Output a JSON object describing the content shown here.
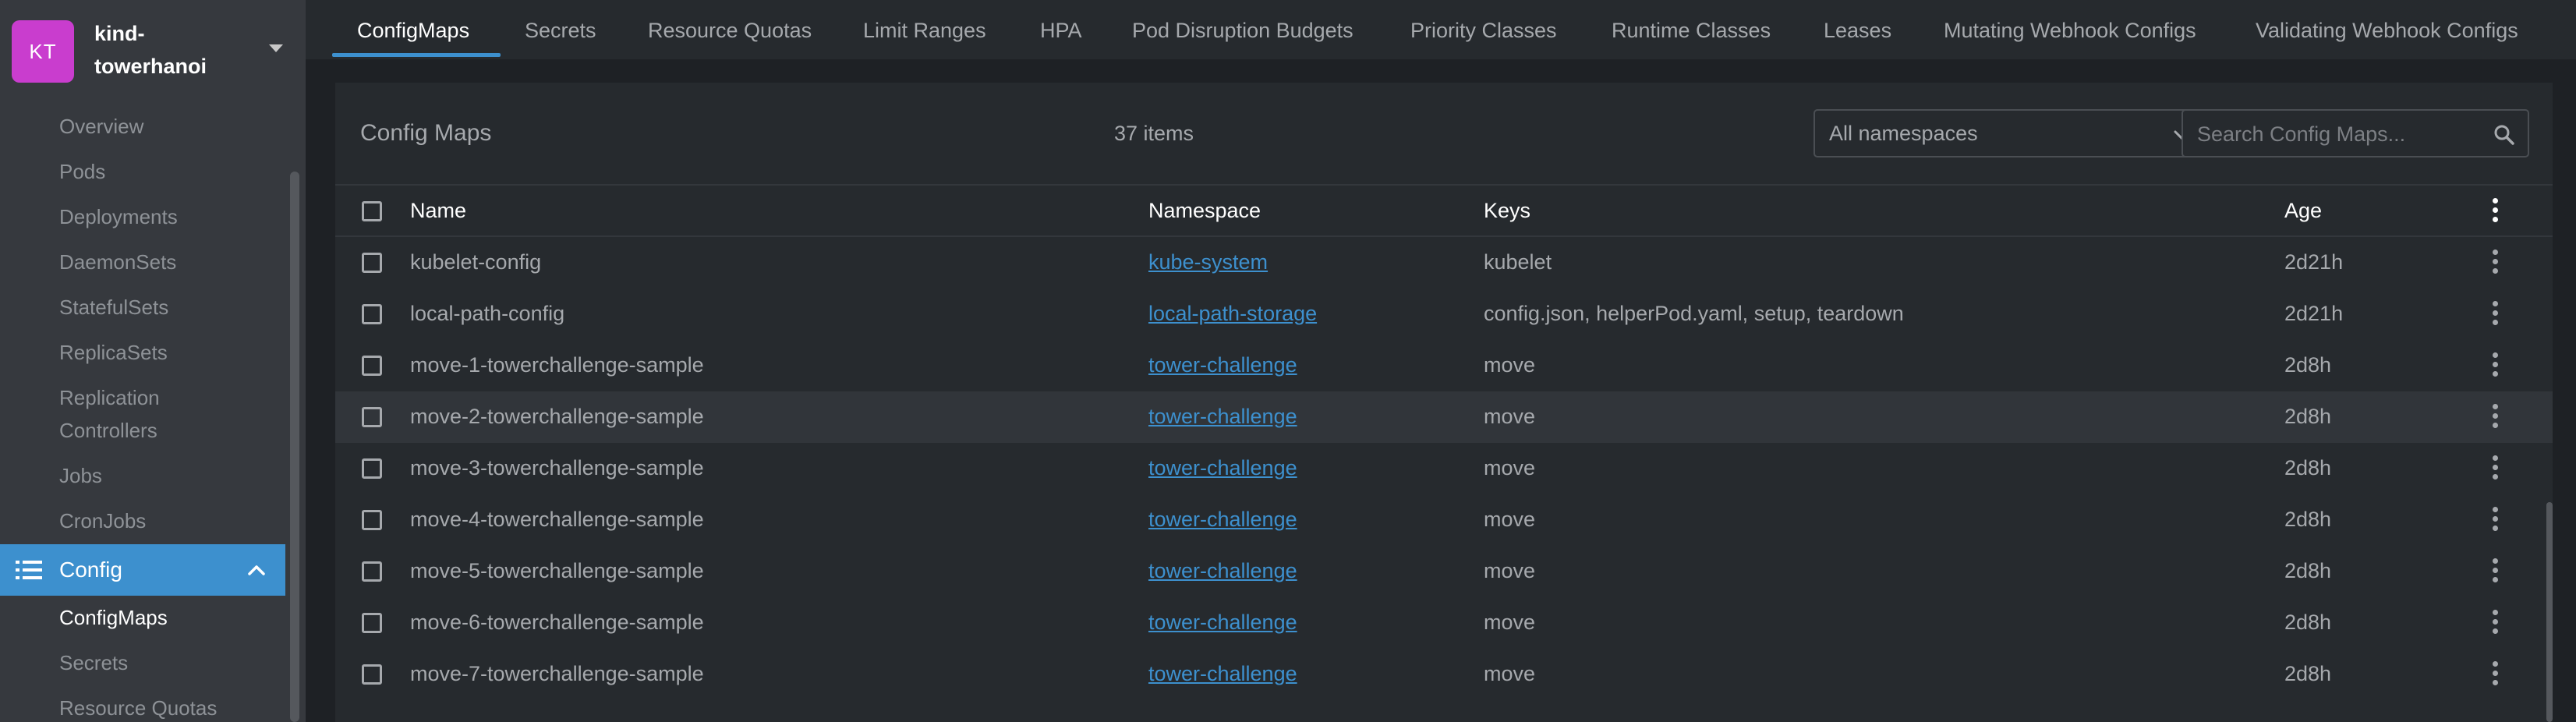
{
  "cluster": {
    "initials": "KT",
    "name": "kind-towerhanoi"
  },
  "sidebar": {
    "items": [
      {
        "label": "Overview"
      },
      {
        "label": "Pods"
      },
      {
        "label": "Deployments"
      },
      {
        "label": "DaemonSets"
      },
      {
        "label": "StatefulSets"
      },
      {
        "label": "ReplicaSets"
      },
      {
        "label": "Replication Controllers"
      },
      {
        "label": "Jobs"
      },
      {
        "label": "CronJobs"
      }
    ],
    "section": {
      "label": "Config",
      "icon": "list-icon",
      "expanded": true
    },
    "sub_items": [
      {
        "label": "ConfigMaps",
        "active": true
      },
      {
        "label": "Secrets",
        "active": false
      },
      {
        "label": "Resource Quotas",
        "active": false
      }
    ]
  },
  "tabs": [
    {
      "label": "ConfigMaps",
      "active": true
    },
    {
      "label": "Secrets"
    },
    {
      "label": "Resource Quotas"
    },
    {
      "label": "Limit Ranges"
    },
    {
      "label": "HPA"
    },
    {
      "label": "Pod Disruption Budgets"
    },
    {
      "label": "Priority Classes"
    },
    {
      "label": "Runtime Classes"
    },
    {
      "label": "Leases"
    },
    {
      "label": "Mutating Webhook Configs"
    },
    {
      "label": "Validating Webhook Configs"
    }
  ],
  "panel": {
    "title": "Config Maps",
    "count": "37 items",
    "namespace_filter": "All namespaces",
    "search_placeholder": "Search Config Maps..."
  },
  "table": {
    "columns": [
      "Name",
      "Namespace",
      "Keys",
      "Age"
    ],
    "rows": [
      {
        "name": "kubelet-config",
        "namespace": "kube-system",
        "keys": "kubelet",
        "age": "2d21h"
      },
      {
        "name": "local-path-config",
        "namespace": "local-path-storage",
        "keys": "config.json, helperPod.yaml, setup, teardown",
        "age": "2d21h"
      },
      {
        "name": "move-1-towerchallenge-sample",
        "namespace": "tower-challenge",
        "keys": "move",
        "age": "2d8h"
      },
      {
        "name": "move-2-towerchallenge-sample",
        "namespace": "tower-challenge",
        "keys": "move",
        "age": "2d8h",
        "highlighted": true
      },
      {
        "name": "move-3-towerchallenge-sample",
        "namespace": "tower-challenge",
        "keys": "move",
        "age": "2d8h"
      },
      {
        "name": "move-4-towerchallenge-sample",
        "namespace": "tower-challenge",
        "keys": "move",
        "age": "2d8h"
      },
      {
        "name": "move-5-towerchallenge-sample",
        "namespace": "tower-challenge",
        "keys": "move",
        "age": "2d8h"
      },
      {
        "name": "move-6-towerchallenge-sample",
        "namespace": "tower-challenge",
        "keys": "move",
        "age": "2d8h"
      },
      {
        "name": "move-7-towerchallenge-sample",
        "namespace": "tower-challenge",
        "keys": "move",
        "age": "2d8h"
      }
    ]
  },
  "colors": {
    "accent": "#3d90ce",
    "avatar": "#c93dce",
    "sidebar_bg": "#36393e",
    "panel_bg": "#262a2e",
    "page_bg": "#1e2125"
  }
}
